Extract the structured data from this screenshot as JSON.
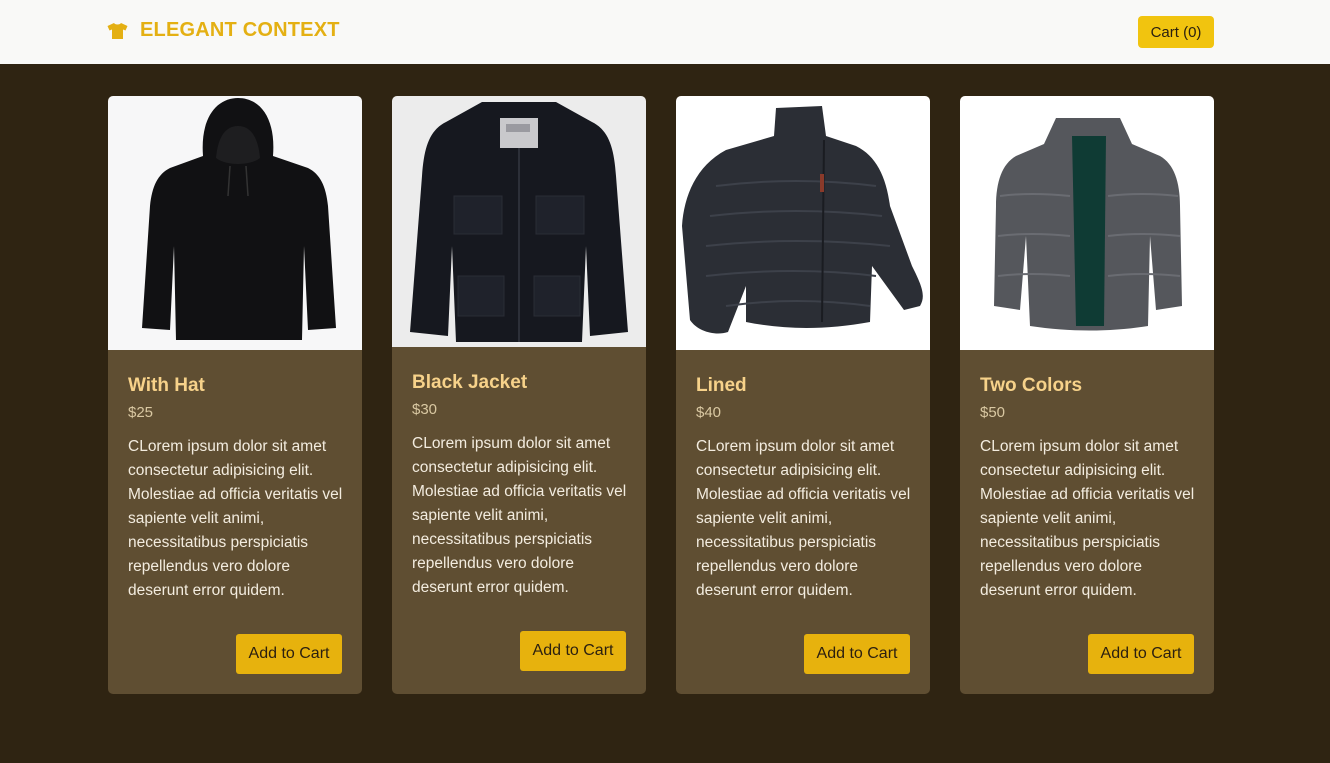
{
  "brand": {
    "name": "ELEGANT CONTEXT",
    "icon": "tshirt-icon",
    "color": "#e4b013"
  },
  "header": {
    "cart_label": "Cart (0)"
  },
  "colors": {
    "background": "#2f2412",
    "card": "#5f4e32",
    "accent": "#e7b20d",
    "title": "#f7d28a"
  },
  "products": [
    {
      "name": "With Hat",
      "price": "$25",
      "description": "CLorem ipsum dolor sit amet consectetur adipisicing elit. Molestiae ad officia veritatis vel sapiente velit animi, necessitatibus perspiciatis repellendus vero dolore deserunt error quidem.",
      "button": "Add to Cart",
      "image": "black-hoodie-image"
    },
    {
      "name": "Black Jacket",
      "price": "$30",
      "description": "CLorem ipsum dolor sit amet consectetur adipisicing elit. Molestiae ad officia veritatis vel sapiente velit animi, necessitatibus perspiciatis repellendus vero dolore deserunt error quidem.",
      "button": "Add to Cart",
      "image": "black-jacket-image"
    },
    {
      "name": "Lined",
      "price": "$40",
      "description": "CLorem ipsum dolor sit amet consectetur adipisicing elit. Molestiae ad officia veritatis vel sapiente velit animi, necessitatibus perspiciatis repellendus vero dolore deserunt error quidem.",
      "button": "Add to Cart",
      "image": "puffer-jacket-image"
    },
    {
      "name": "Two Colors",
      "price": "$50",
      "description": "CLorem ipsum dolor sit amet consectetur adipisicing elit. Molestiae ad officia veritatis vel sapiente velit animi, necessitatibus perspiciatis repellendus vero dolore deserunt error quidem.",
      "button": "Add to Cart",
      "image": "grey-puffer-jacket-image"
    }
  ]
}
